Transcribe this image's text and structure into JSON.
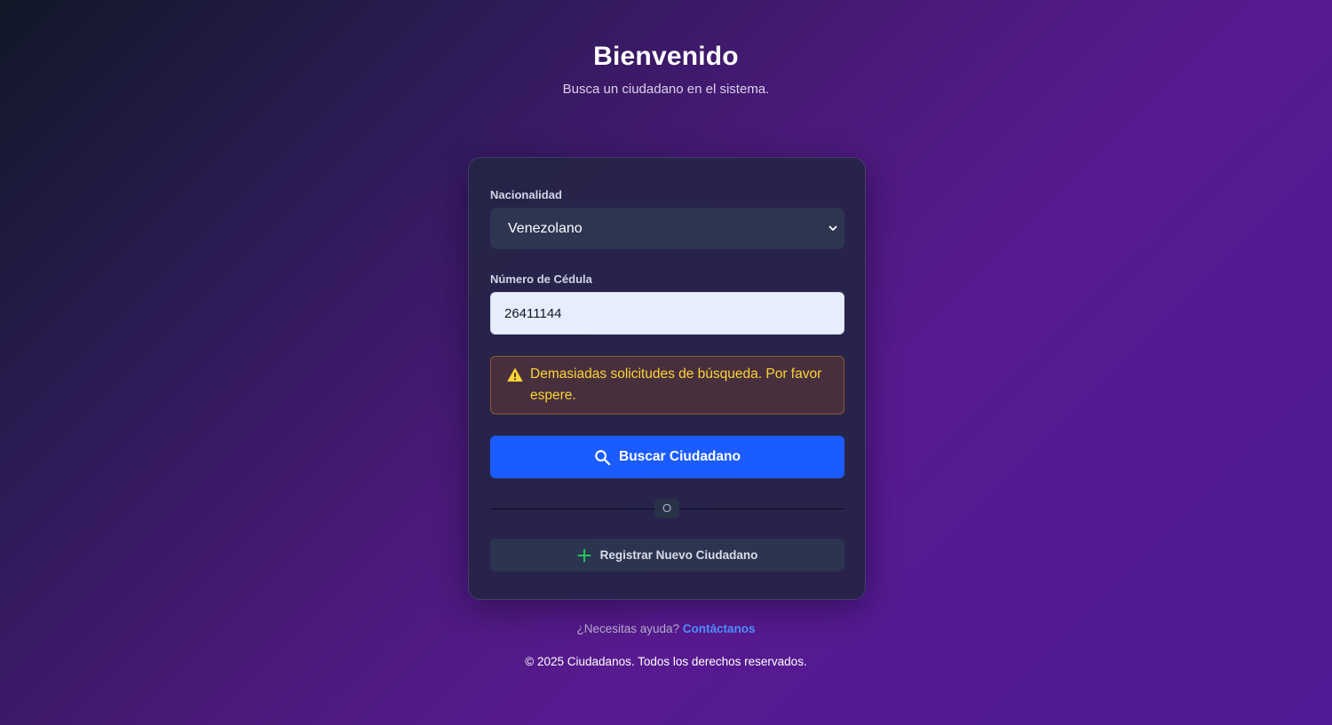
{
  "header": {
    "title": "Bienvenido",
    "subtitle": "Busca un ciudadano en el sistema."
  },
  "form": {
    "nationality_label": "Nacionalidad",
    "nationality_value": "Venezolano",
    "id_label": "Número de Cédula",
    "id_value": "26411144",
    "alert_text": "Demasiadas solicitudes de búsqueda. Por favor espere.",
    "search_button": "Buscar Ciudadano",
    "divider_text": "O",
    "register_button": "Registrar Nuevo Ciudadano"
  },
  "help": {
    "question": "¿Necesitas ayuda?",
    "link": "Contáctanos"
  },
  "footer": {
    "copyright": "© 2025 Ciudadanos. Todos los derechos reservados."
  },
  "icons": {
    "dropdown": "chevron-down-icon",
    "alert": "warning-icon",
    "search": "search-icon",
    "register": "plus-icon"
  },
  "colors": {
    "primary": "#1a5cff",
    "link": "#4f8dff",
    "warning_text": "#fcd535",
    "plus_icon": "#22c55e"
  }
}
